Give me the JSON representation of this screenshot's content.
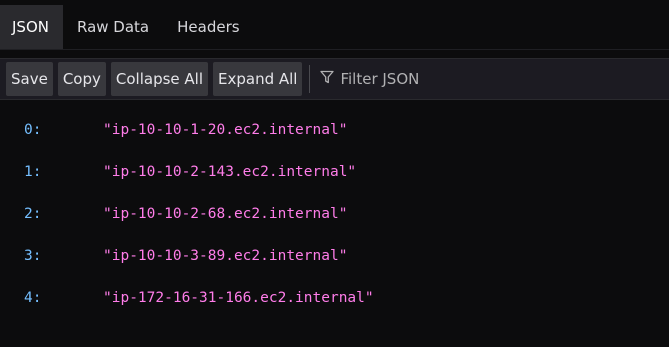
{
  "tabs": [
    {
      "label": "JSON",
      "active": true
    },
    {
      "label": "Raw Data",
      "active": false
    },
    {
      "label": "Headers",
      "active": false
    }
  ],
  "toolbar": {
    "save_label": "Save",
    "copy_label": "Copy",
    "collapse_label": "Collapse All",
    "expand_label": "Expand All",
    "filter_placeholder": "Filter JSON",
    "filter_icon": "funnel-icon"
  },
  "json_rows": [
    {
      "key": "0:",
      "value": "\"ip-10-10-1-20.ec2.internal\""
    },
    {
      "key": "1:",
      "value": "\"ip-10-10-2-143.ec2.internal\""
    },
    {
      "key": "2:",
      "value": "\"ip-10-10-2-68.ec2.internal\""
    },
    {
      "key": "3:",
      "value": "\"ip-10-10-3-89.ec2.internal\""
    },
    {
      "key": "4:",
      "value": "\"ip-172-16-31-166.ec2.internal\""
    }
  ],
  "colors": {
    "key": "#75bfff",
    "string": "#ff7de9",
    "background": "#0c0c0d",
    "toolbar": "#1c1b22",
    "button": "#38383d"
  }
}
